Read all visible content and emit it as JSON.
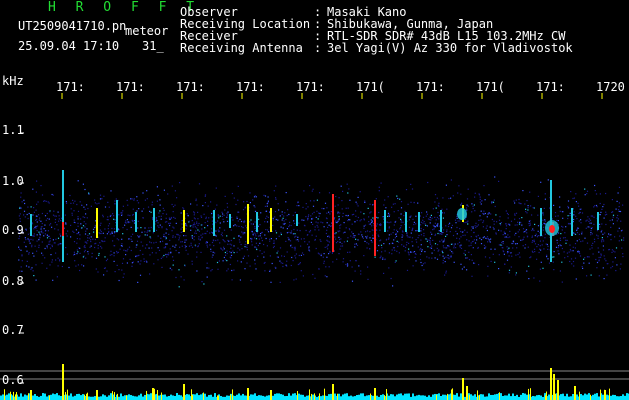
{
  "header": {
    "brand": "H R O F F T",
    "filename": "UT2509041710.pn",
    "meteor_label": "meteor",
    "datetime": "25.09.04 17:10",
    "count": "31_",
    "fields": [
      {
        "label": "Observer",
        "sep": ":",
        "value": "Masaki Kano"
      },
      {
        "label": "Receiving Location",
        "sep": ":",
        "value": "Shibukawa, Gunma, Japan"
      },
      {
        "label": "Receiver",
        "sep": ":",
        "value": "RTL-SDR SDR# 43dB L15 103.2MHz CW"
      },
      {
        "label": "Receiving Antenna",
        "sep": ":",
        "value": "3el Yagi(V) Az 330 for Vladivostok"
      }
    ]
  },
  "axis": {
    "y_unit": "kHz",
    "y_ticks": [
      "1.1",
      "1.0",
      "0.9",
      "0.8",
      "0.7",
      "0.6"
    ],
    "x_ticks": [
      "171:",
      "171:",
      "171:",
      "171:",
      "171:",
      "171(",
      "171:",
      "171(",
      "171:",
      "1720"
    ]
  },
  "colors": {
    "background": "#000000",
    "brand": "#22dd33",
    "axis_text": "#ffffff",
    "tick_marks": "#ffff00",
    "noise_low": "#1a1a8c",
    "noise_mid": "#3b55ff",
    "echo_mid": "#22c8e0",
    "echo_high": "#ffff00",
    "echo_peak": "#ff2222",
    "power_bars": "#ffff00",
    "power_floor": "#00e5ff"
  }
}
